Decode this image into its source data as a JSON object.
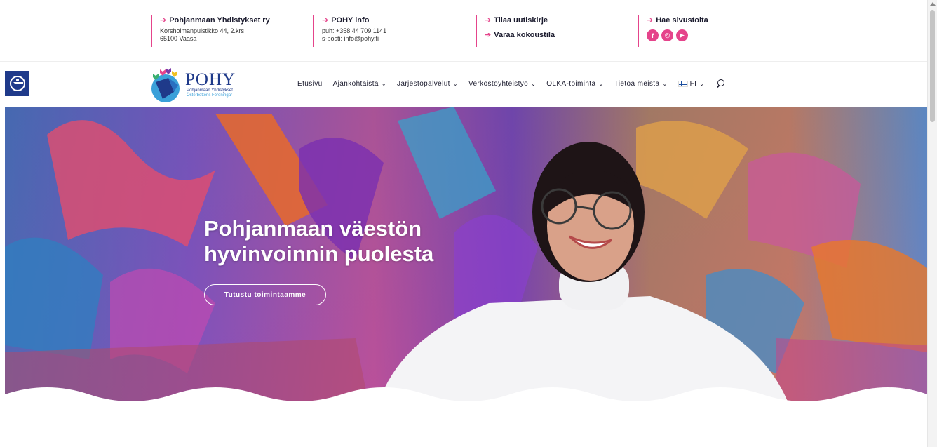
{
  "topbar": {
    "col1": {
      "title": "Pohjanmaan Yhdistykset ry",
      "line1": "Korsholmanpuistikko 44, 2.krs",
      "line2": "65100 Vaasa"
    },
    "col2": {
      "title": "POHY info",
      "line1": "puh: +358 44 709 1141",
      "line2": "s-posti: info@pohy.fi"
    },
    "col3": {
      "link1": "Tilaa uutiskirje",
      "link2": "Varaa kokoustila"
    },
    "col4": {
      "title": "Hae sivustolta",
      "social": [
        "f",
        "ig",
        "yt"
      ]
    }
  },
  "logo": {
    "brand": "POHY",
    "tag1": "Pohjanmaan Yhdistykset",
    "tag2": "Österbottens Föreningar"
  },
  "nav": {
    "items": [
      {
        "label": "Etusivu",
        "dropdown": false
      },
      {
        "label": "Ajankohtaista",
        "dropdown": true
      },
      {
        "label": "Järjestöpalvelut",
        "dropdown": true
      },
      {
        "label": "Verkostoyhteistyö",
        "dropdown": true
      },
      {
        "label": "OLKA-toiminta",
        "dropdown": true
      },
      {
        "label": "Tietoa meistä",
        "dropdown": true
      }
    ],
    "lang": "FI"
  },
  "hero": {
    "title_line1": "Pohjanmaan väestön",
    "title_line2": "hyvinvoinnin puolesta",
    "button": "Tutustu toimintaamme"
  },
  "colors": {
    "accent": "#e5448b",
    "brand": "#1f3a8a"
  }
}
